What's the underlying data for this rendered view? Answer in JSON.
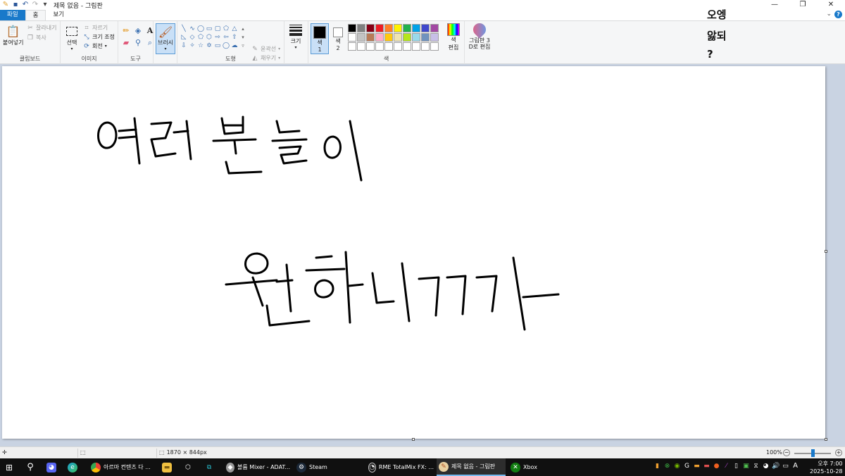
{
  "window": {
    "title": "제목 없음 - 그림판",
    "controls": {
      "minimize": "—",
      "restore": "❐",
      "close": "✕"
    }
  },
  "quick_access": {
    "save_icon": "save-icon",
    "undo_icon": "undo-icon",
    "redo_icon": "redo-icon",
    "customize": "▾"
  },
  "tabs": [
    {
      "label": "파일"
    },
    {
      "label": "홈"
    },
    {
      "label": "보기"
    }
  ],
  "ribbon": {
    "clipboard": {
      "label": "클립보드",
      "paste": "붙여넣기",
      "cut": "잘라내기",
      "copy": "복사"
    },
    "image": {
      "label": "이미지",
      "select": "선택",
      "crop": "자르기",
      "resize": "크기 조정",
      "rotate": "회전"
    },
    "tools": {
      "label": "도구"
    },
    "brushes": {
      "label": "브러시"
    },
    "shapes": {
      "label": "도형",
      "outline": "윤곽선",
      "fill": "채우기"
    },
    "size": {
      "label": "크기"
    },
    "colors": {
      "label": "색",
      "color1": "색\n1",
      "color1_top": "색",
      "color1_num": "1",
      "color2_top": "색",
      "color2_num": "2",
      "color1_value": "#000000",
      "color2_value": "#ffffff",
      "edit_top": "색",
      "edit_bottom": "편집",
      "palette": [
        "#000000",
        "#7f7f7f",
        "#880015",
        "#ed1c24",
        "#ff7f27",
        "#fff200",
        "#22b14c",
        "#00a2e8",
        "#3f48cc",
        "#a349a4",
        "#ffffff",
        "#c3c3c3",
        "#b97a57",
        "#ffaec9",
        "#ffc90e",
        "#efe4b0",
        "#b5e61d",
        "#99d9ea",
        "#7092be",
        "#c8bfe7",
        "#ffffff",
        "#ffffff",
        "#ffffff",
        "#ffffff",
        "#ffffff",
        "#ffffff",
        "#ffffff",
        "#ffffff",
        "#ffffff",
        "#ffffff"
      ]
    },
    "paint3d": {
      "line1": "그림판 3",
      "line2": "D로 편집"
    }
  },
  "overlay": {
    "line1": "오엥",
    "line2": "앓되",
    "line3": "?"
  },
  "canvas": {
    "handwriting_line1": "여러분들이",
    "handwriting_line2": "원하니까"
  },
  "statusbar": {
    "dimensions": "1870 × 844px",
    "zoom": "100%",
    "zoom_out": "−",
    "zoom_in": "+"
  },
  "taskbar": {
    "items": [
      {
        "label": "아르마 컨텐츠 다 ..."
      },
      {
        "label": "볼륨 Mixer - ADAT..."
      },
      {
        "label": "Steam"
      },
      {
        "label": "RME TotalMix FX: ..."
      },
      {
        "label": "제목 없음 - 그림판"
      },
      {
        "label": "Xbox"
      }
    ],
    "clock": {
      "ampm_time": "오후 7:00",
      "date": "2025-10-28"
    },
    "ime": "A"
  }
}
